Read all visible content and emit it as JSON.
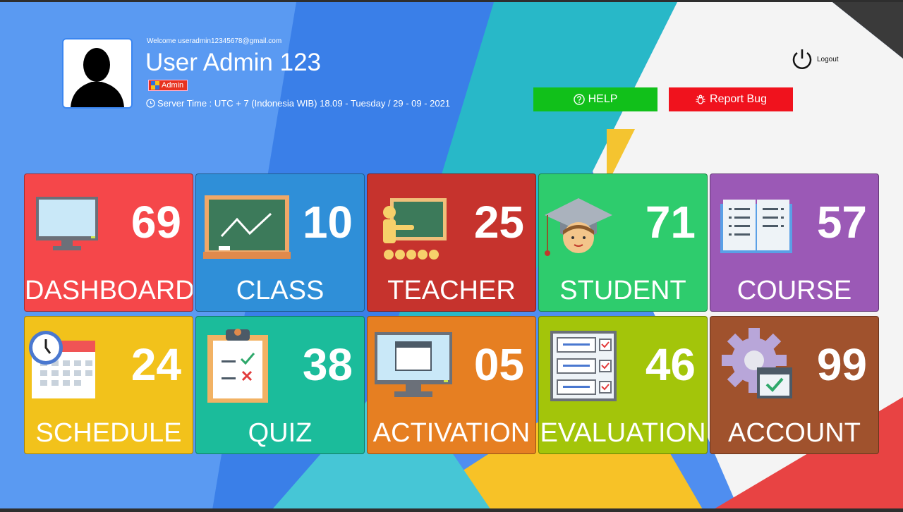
{
  "header": {
    "welcome": "Welcome useradmin12345678@gmail.com",
    "user_name": "User Admin 123",
    "role_badge": "Admin",
    "server_time": "Server Time : UTC + 7 (Indonesia WIB) 18.09 - Tuesday / 29 - 09 - 2021",
    "logout_label": "Logout"
  },
  "buttons": {
    "help": "HELP",
    "report_bug": "Report Bug"
  },
  "tiles": [
    {
      "label": "DASHBOARD",
      "count": "69",
      "color": "#f5474a",
      "icon": "monitor-icon"
    },
    {
      "label": "CLASS",
      "count": "10",
      "color": "#2f8fd8",
      "icon": "chalkboard-icon"
    },
    {
      "label": "TEACHER",
      "count": "25",
      "color": "#c6332d",
      "icon": "teacher-icon"
    },
    {
      "label": "STUDENT",
      "count": "71",
      "color": "#2ecc6d",
      "icon": "graduate-icon"
    },
    {
      "label": "COURSE",
      "count": "57",
      "color": "#9b59b6",
      "icon": "open-book-icon"
    },
    {
      "label": "SCHEDULE",
      "count": "24",
      "color": "#f2c21b",
      "icon": "calendar-clock-icon"
    },
    {
      "label": "QUIZ",
      "count": "38",
      "color": "#1bbc9b",
      "icon": "clipboard-checklist-icon"
    },
    {
      "label": "ACTIVATION",
      "count": "05",
      "color": "#e67f22",
      "icon": "computer-window-icon"
    },
    {
      "label": "EVALUATION",
      "count": "46",
      "color": "#a3c50a",
      "icon": "checklist-form-icon"
    },
    {
      "label": "ACCOUNT",
      "count": "99",
      "color": "#a0522d",
      "icon": "gear-check-icon"
    }
  ]
}
